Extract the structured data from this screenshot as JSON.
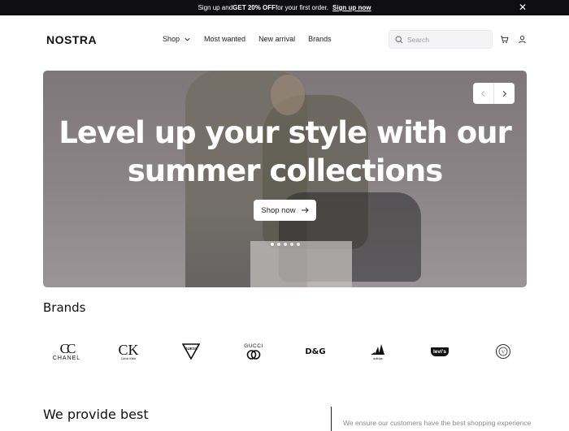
{
  "promo": {
    "text_prefix": "Sign up and ",
    "text_bold": "GET 20% OFF",
    "text_suffix": " for your first order.",
    "link": "Sign up now",
    "close": "✕"
  },
  "header": {
    "logo": "NOSTRA",
    "nav": [
      {
        "label": "Shop",
        "has_dropdown": true
      },
      {
        "label": "Most wanted"
      },
      {
        "label": "New arrival"
      },
      {
        "label": "Brands"
      }
    ],
    "search_placeholder": "Search",
    "icons": [
      "cart-icon",
      "user-icon"
    ]
  },
  "hero": {
    "title_line1": "Level up your style with our",
    "title_line2": "summer collections",
    "cta": "Shop now",
    "slide_count": 5,
    "active_slide": 1
  },
  "brands": {
    "title": "Brands",
    "items": [
      {
        "name": "CHANEL",
        "mark": "CC"
      },
      {
        "name": "Calvin Klein",
        "mark": "CK"
      },
      {
        "name": "GUESS",
        "mark": "▽"
      },
      {
        "name": "GUCCI",
        "mark": "GG"
      },
      {
        "name": "D&G",
        "mark": "D&G"
      },
      {
        "name": "adidas",
        "mark": "adidas"
      },
      {
        "name": "Levi's",
        "mark": "levi's"
      },
      {
        "name": "VERSACE",
        "mark": "V"
      }
    ]
  },
  "provide": {
    "title": "We provide best",
    "text": "We ensure our customers have the best shopping experience"
  },
  "colors": {
    "dark": "#0f0f12",
    "text": "#111111",
    "muted": "#8a8a8f",
    "hero_bg": "#8b8587"
  }
}
